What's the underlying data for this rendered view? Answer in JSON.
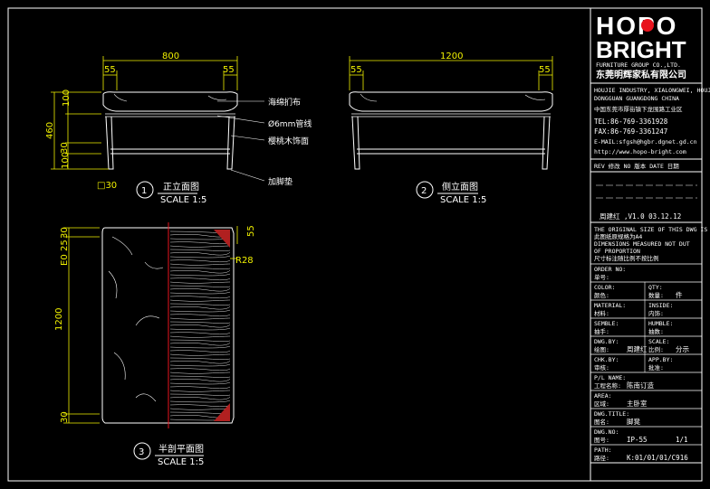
{
  "logo": {
    "line1": "HOPO",
    "line2": "BRIGHT",
    "accent": "#e8141e"
  },
  "company": {
    "en": "FURNITURE GROUP CO.,LTD.",
    "cn": "东莞明辉家私有限公司",
    "addr1": "HOUJIE INDUSTRY, XIALONGWEI, HOUJIE",
    "addr2": "DONGGUAN GUANGDONG CHINA",
    "addr_cn": "中国东莞市厚街镇下龙围路工业区",
    "tel": "TEL:86-769-3361928",
    "fax": "FAX:86-769-3361247",
    "email": "E-MAIL:sfgsh@hgbr.dgnet.gd.cn",
    "web": "http://www.hopo-bright.com"
  },
  "views": {
    "front": {
      "num": "1",
      "title": "正立面图",
      "scale": "SCALE 1:5",
      "dims": {
        "width": "800",
        "side_l": "55",
        "side_r": "55",
        "h_total": "460",
        "h_top": "100",
        "h_mid": "30",
        "h_low": "100",
        "h_bot": "30",
        "leg": "□30"
      },
      "callouts": [
        "海绵扪布",
        "Ø6mm管线",
        "樱桃木饰面",
        "加脚垫"
      ]
    },
    "side": {
      "num": "2",
      "title": "侧立面图",
      "scale": "SCALE 1:5",
      "dims": {
        "width": "1200",
        "side_l": "55",
        "side_r": "55"
      }
    },
    "plan": {
      "num": "3",
      "title": "半剖平面图",
      "scale": "SCALE 1:5",
      "dims": {
        "depth": "1200",
        "edge": "E0",
        "t25": "25",
        "t30": "30",
        "e55": "55",
        "r28": "R28"
      }
    }
  },
  "title_block": {
    "rev_head": "REV 修改    NO 版本    DATE 日期",
    "revision": "周建红 ,V1.0  03.12.12",
    "notes": [
      "THE ORIGINAL SIZE OF THIS DWG IS A4",
      "此图纸原规格为A4",
      "DIMENSIONS MEASURED NOT DUT",
      "OF PROPORTION",
      "尺寸标注随比例不按比例"
    ],
    "rows": [
      {
        "l_en": "ORDER NO:",
        "l_cn": "单号:",
        "r_en": "",
        "r_cn": ""
      },
      {
        "l_en": "COLOR:",
        "l_cn": "颜色:",
        "r_en": "QTY:",
        "r_cn": "数量:",
        "r_val": "件"
      },
      {
        "l_en": "MATERIAL:",
        "l_cn": "材料:",
        "r_en": "INSIDE:",
        "r_cn": "内饰:"
      },
      {
        "l_en": "SEMBLE:",
        "l_cn": "抽手:",
        "r_en": "HUMBLE:",
        "r_cn": "抽数:"
      },
      {
        "l_en": "DWG.BY:",
        "l_cn": "绘图:",
        "l_val": "周建红",
        "r_en": "SCALE:",
        "r_cn": "比例:",
        "r_val": "分示"
      },
      {
        "l_en": "CHK.BY:",
        "l_cn": "审核:",
        "r_en": "APP.BY:",
        "r_cn": "批准:"
      },
      {
        "l_en": "P/L NAME:",
        "l_cn": "工程名称:",
        "l_val": "陈南订造"
      },
      {
        "l_en": "AREA:",
        "l_cn": "区域:",
        "l_val": "主卧室"
      },
      {
        "l_en": "DWG.TITLE:",
        "l_cn": "图名:",
        "l_val": "脚凳"
      },
      {
        "l_en": "DWG.NO:",
        "l_cn": "图号:",
        "l_val": "IP-55",
        "r_val": "1/1"
      },
      {
        "l_en": "PATH:",
        "l_cn": "路径:",
        "l_val": "K:01/01/01/C916"
      }
    ]
  }
}
